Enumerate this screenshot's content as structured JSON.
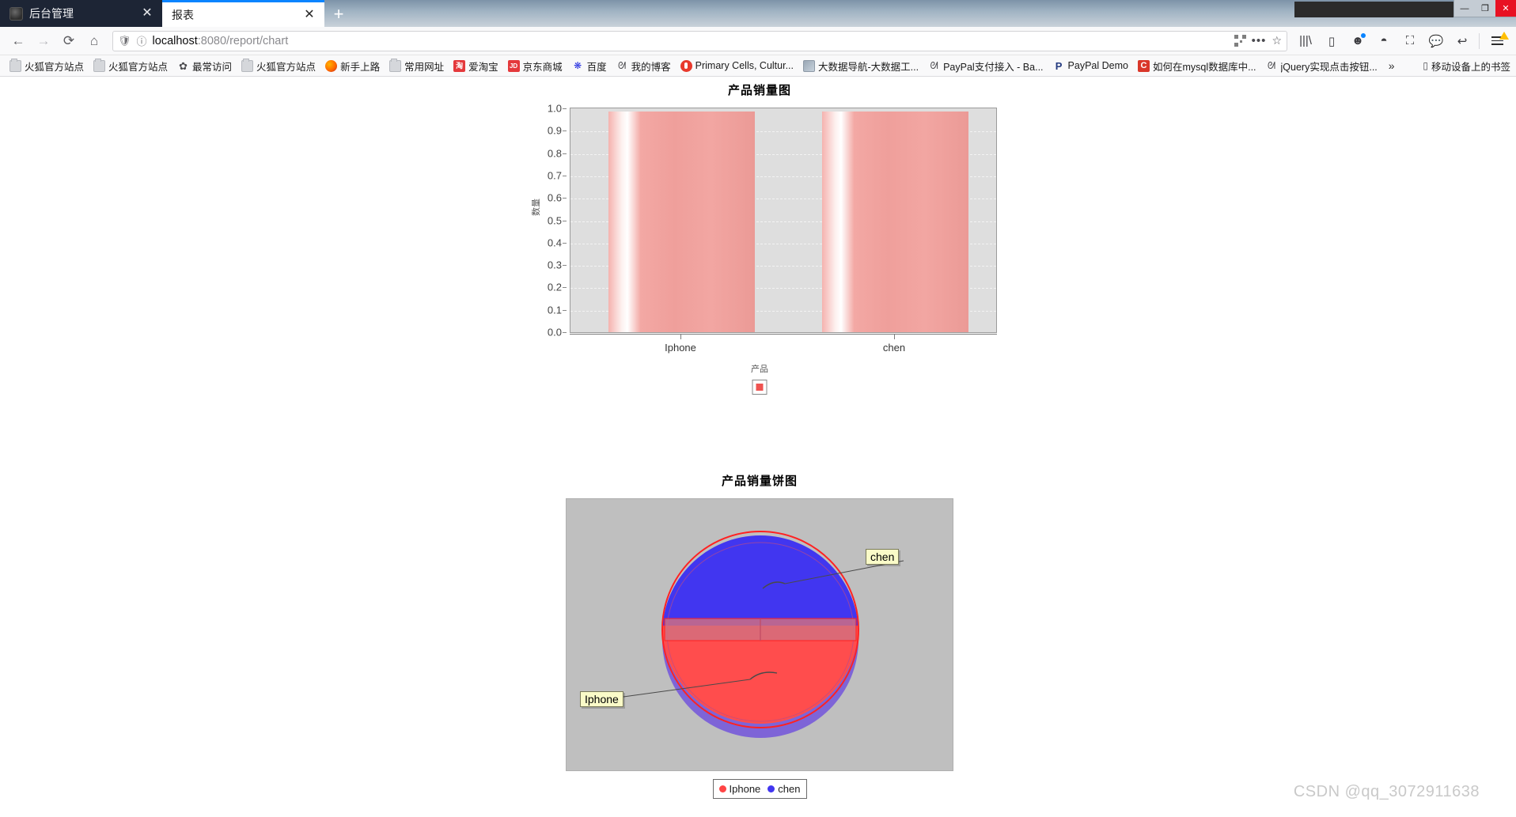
{
  "window": {
    "minimize_label": "—",
    "maximize_label": "❐",
    "close_label": "✕"
  },
  "tabs": [
    {
      "title": "后台管理",
      "close_label": "✕",
      "active": false
    },
    {
      "title": "报表",
      "close_label": "✕",
      "active": true
    }
  ],
  "newtab_label": "+",
  "nav": {
    "back_label": "←",
    "forward_label": "→",
    "reload_label": "⟳",
    "home_label": "⌂",
    "url_prefix": "localhost",
    "url_suffix": ":8080/report/chart",
    "url_full": "localhost:8080/report/chart",
    "shield_label": "🛡",
    "info_label": "ⓘ",
    "menu_dots_label": "•••",
    "bookmark_star_label": "☆"
  },
  "toolbar_icons": [
    {
      "name": "library-icon",
      "glyph": "|||\\"
    },
    {
      "name": "sidebar-icon",
      "glyph": "▯"
    },
    {
      "name": "account-icon",
      "glyph": "☻"
    },
    {
      "name": "sync-globe-icon",
      "glyph": "◓"
    },
    {
      "name": "screenshot-icon",
      "glyph": "⛶"
    },
    {
      "name": "chat-icon",
      "glyph": "💬"
    },
    {
      "name": "undo-icon",
      "glyph": "↩"
    }
  ],
  "bookmarks": [
    {
      "label": "火狐官方站点",
      "icon": "folder"
    },
    {
      "label": "火狐官方站点",
      "icon": "folder"
    },
    {
      "label": "最常访问",
      "icon": "gear",
      "glyph": "✿"
    },
    {
      "label": "火狐官方站点",
      "icon": "folder"
    },
    {
      "label": "新手上路",
      "icon": "ff"
    },
    {
      "label": "常用网址",
      "icon": "folder"
    },
    {
      "label": "爱淘宝",
      "icon": "tao",
      "glyph": "淘"
    },
    {
      "label": "京东商城",
      "icon": "jd",
      "glyph": "JD"
    },
    {
      "label": "百度",
      "icon": "baidu",
      "glyph": "❋"
    },
    {
      "label": "我的博客",
      "icon": "blog",
      "glyph": "ᘛ"
    },
    {
      "label": "Primary Cells, Cultur...",
      "icon": "red-o"
    },
    {
      "label": "大数据导航-大数据工...",
      "icon": "grayimg"
    },
    {
      "label": "PayPal支付接入 - Ba...",
      "icon": "blog",
      "glyph": "ᘛ"
    },
    {
      "label": "PayPal Demo",
      "icon": "paypal",
      "glyph": "P"
    },
    {
      "label": "如何在mysql数据库中...",
      "icon": "csdn",
      "glyph": "C"
    },
    {
      "label": "jQuery实现点击按钮...",
      "icon": "blog",
      "glyph": "ᘛ"
    }
  ],
  "bookmarks_overflow_label": "»",
  "bookmarks_mobile": {
    "label": "移动设备上的书签",
    "glyph": "▯"
  },
  "chart_data": [
    {
      "type": "bar",
      "title": "产品销量图",
      "categories": [
        "Iphone",
        "chen"
      ],
      "values": [
        1.0,
        1.0
      ],
      "xlabel": "产品",
      "ylabel": "数量",
      "ylim": [
        0.0,
        1.0
      ],
      "yticks": [
        "1.0",
        "0.9",
        "0.8",
        "0.7",
        "0.6",
        "0.5",
        "0.4",
        "0.3",
        "0.2",
        "0.1",
        "0.0"
      ],
      "grid": true,
      "legend_position": "bottom",
      "series_color": "#ef5350",
      "plot_background": "#dedede"
    },
    {
      "type": "pie",
      "title": "产品销量饼图",
      "categories": [
        "Iphone",
        "chen"
      ],
      "values": [
        50,
        50
      ],
      "labels": [
        "Iphone",
        "chen"
      ],
      "colors": [
        "#ff4444",
        "#4136f0"
      ],
      "legend_position": "bottom",
      "plot_background": "#bfbfbf"
    }
  ],
  "watermark": "CSDN @qq_3072911638"
}
